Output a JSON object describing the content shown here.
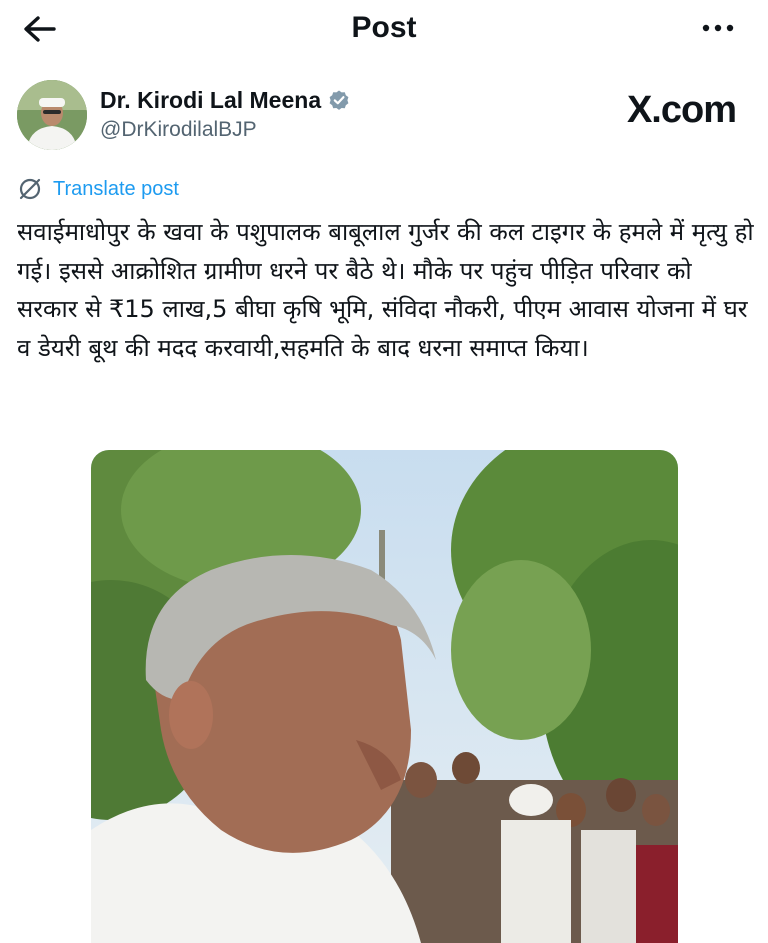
{
  "header": {
    "title": "Post"
  },
  "author": {
    "name": "Dr. Kirodi Lal Meena",
    "handle": "@DrKirodilalBJP",
    "verified_color": "#829aab"
  },
  "watermark": "X.com",
  "translate": {
    "label": "Translate post"
  },
  "post": {
    "text": "सवाईमाधोपुर के खवा के पशुपालक बाबूलाल गुर्जर की कल टाइगर के हमले में मृत्यु हो गई। इससे आक्रोशित ग्रामीण धरने पर बैठे थे। मौके पर पहुंच पीड़ित परिवार को सरकार से ₹15 लाख,5 बीघा कृषि भूमि, संविदा नौकरी, पीएम आवास योजना में घर व डेयरी बूथ की मदद करवायी,सहमति के बाद धरना समाप्त किया।"
  },
  "colors": {
    "link": "#1d9bf0",
    "secondary_text": "#536471"
  },
  "icons": [
    "back-arrow-icon",
    "more-options-icon",
    "verified-badge-icon",
    "translate-icon"
  ]
}
